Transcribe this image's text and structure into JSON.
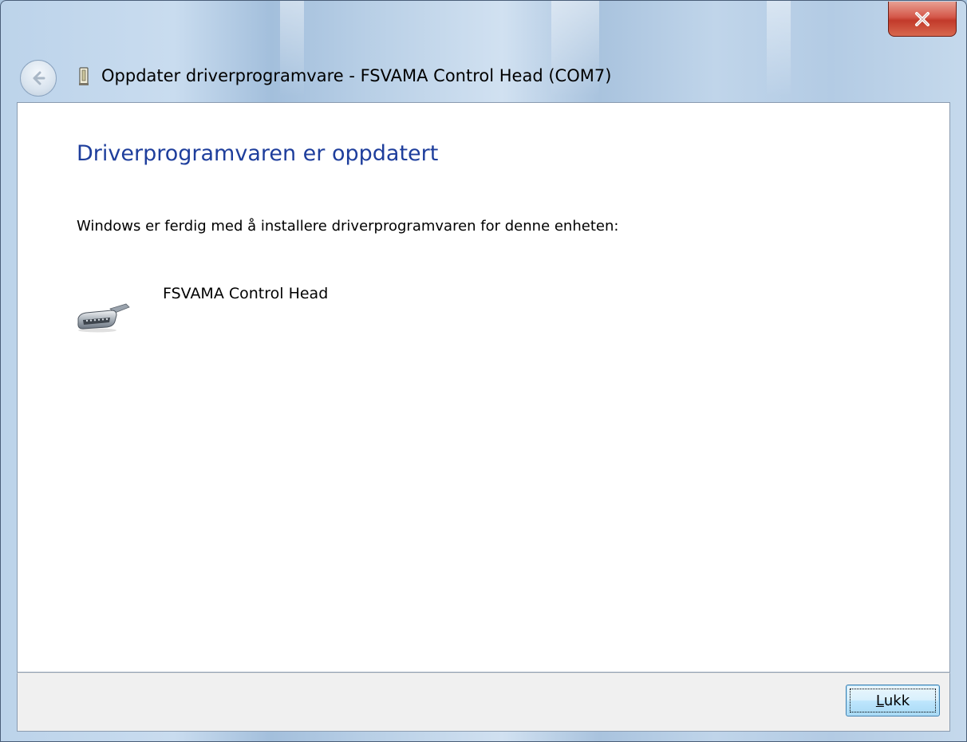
{
  "window": {
    "title": "Oppdater driverprogramvare - FSVAMA Control Head (COM7)"
  },
  "titlebar": {
    "close_icon": "close-x-icon",
    "back_icon": "back-arrow-icon",
    "window_icon": "device-port-icon"
  },
  "content": {
    "heading": "Driverprogramvaren er oppdatert",
    "message": "Windows er ferdig med å installere driverprogramvaren for denne enheten:",
    "device": {
      "name": "FSVAMA Control Head",
      "icon": "serial-port-device-icon"
    }
  },
  "footer": {
    "close_button": {
      "label_first": "L",
      "label_rest": "ukk"
    }
  },
  "colors": {
    "heading": "#1e3e9c",
    "close_button_red": "#c23a2a",
    "footer_bg": "#f0f0f0",
    "button_border": "#3c7fb1"
  }
}
